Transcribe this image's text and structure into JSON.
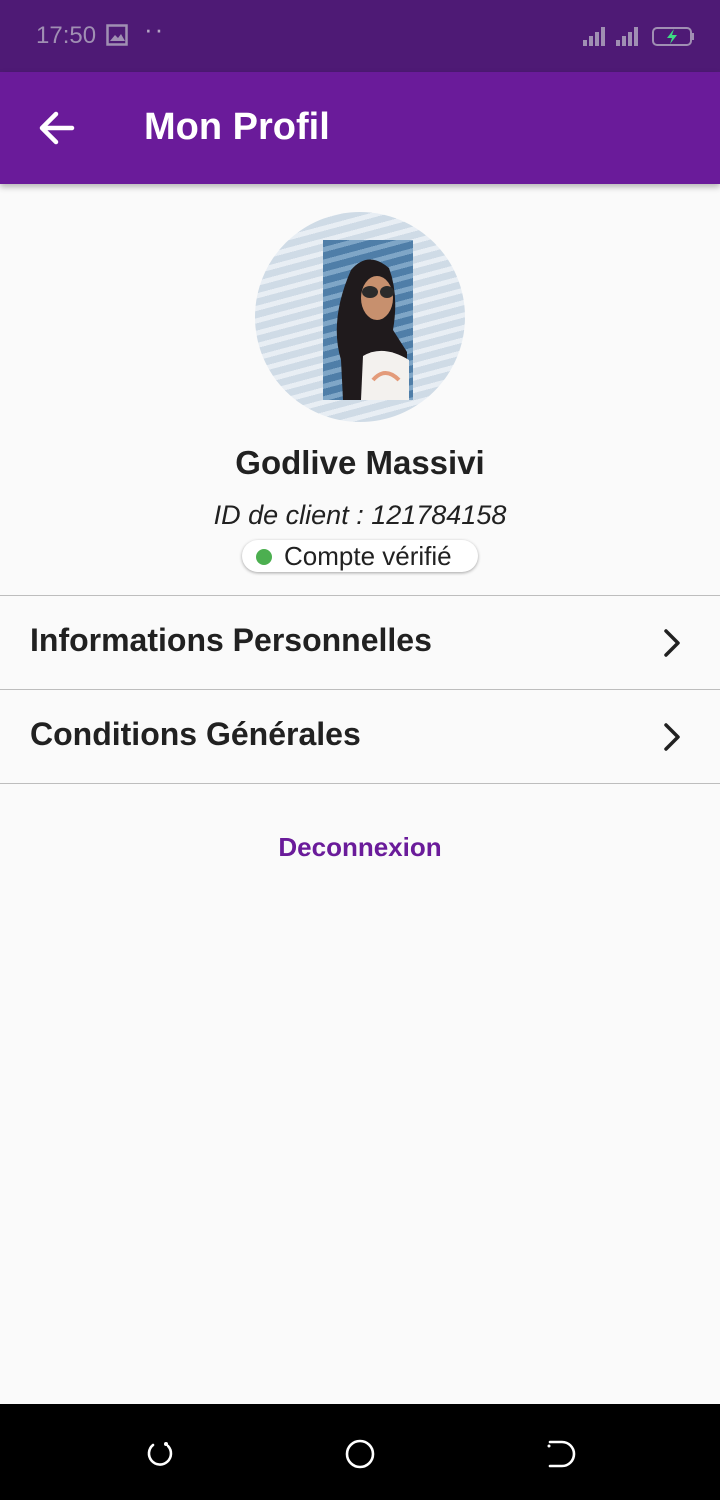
{
  "status_bar": {
    "time": "17:50",
    "icons": [
      "image-icon",
      "more-dots-icon",
      "signal-icon",
      "signal-icon",
      "battery-charging-icon"
    ]
  },
  "app_bar": {
    "back_icon": "arrow-back-icon",
    "title": "Mon Profil",
    "color": "#6a1b9a"
  },
  "profile": {
    "name": "Godlive Massivi",
    "client_id_label": "ID de client : ",
    "client_id": "121784158",
    "verified_label": "Compte vérifié",
    "verified_color": "#4caf50"
  },
  "menu": {
    "items": [
      {
        "label": "Informations Personnelles",
        "icon": "chevron-right-icon"
      },
      {
        "label": "Conditions Générales",
        "icon": "chevron-right-icon"
      }
    ]
  },
  "logout_label": "Deconnexion",
  "nav_bar": {
    "buttons": [
      "recent-apps-icon",
      "home-icon",
      "back-icon"
    ]
  }
}
